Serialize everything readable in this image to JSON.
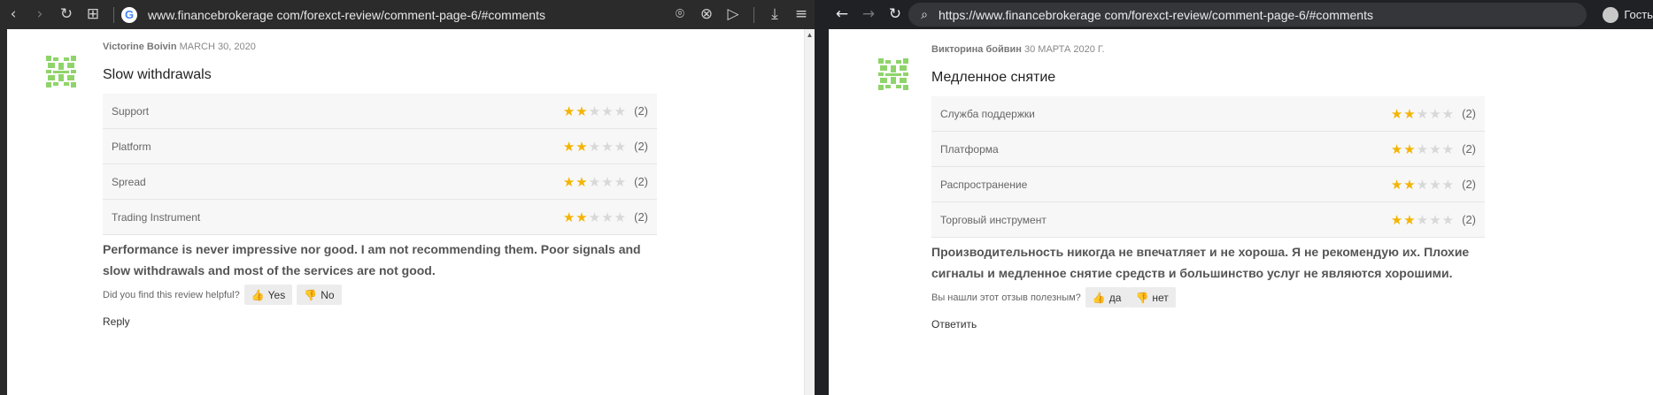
{
  "left": {
    "url": "www.financebrokerage com/forexct-review/comment-page-6/#comments",
    "google_glyph": "G",
    "review": {
      "author": "Victorine Boivin",
      "date": "MARCH 30, 2020",
      "title": "Slow withdrawals",
      "ratings": [
        {
          "label": "Support",
          "rating": 2,
          "count": "(2)"
        },
        {
          "label": "Platform",
          "rating": 2,
          "count": "(2)"
        },
        {
          "label": "Spread",
          "rating": 2,
          "count": "(2)"
        },
        {
          "label": "Trading Instrument",
          "rating": 2,
          "count": "(2)"
        }
      ],
      "text": "Performance is never impressive nor good. I am not recommending them. Poor signals and slow withdrawals and most of the services are not good.",
      "helpful_question": "Did you find this review helpful?",
      "yes_label": "Yes",
      "no_label": "No",
      "reply_label": "Reply"
    }
  },
  "right": {
    "url": "https://www.financebrokerage com/forexct-review/comment-page-6/#comments",
    "profile_label": "Гость",
    "review": {
      "author": "Викторина бойвин",
      "date": "30 МАРТА 2020 Г.",
      "title": "Медленное снятие",
      "ratings": [
        {
          "label": "Служба поддержки",
          "rating": 2,
          "count": "(2)"
        },
        {
          "label": "Платформа",
          "rating": 2,
          "count": "(2)"
        },
        {
          "label": "Распространение",
          "rating": 2,
          "count": "(2)"
        },
        {
          "label": "Торговый инструмент",
          "rating": 2,
          "count": "(2)"
        }
      ],
      "text": "Производительность никогда не впечатляет и не хороша. Я не рекомендую их. Плохие сигналы и медленное снятие средств и большинство услуг не являются хорошими.",
      "helpful_question": "Вы нашли этот отзыв полезным?",
      "yes_label": "да",
      "no_label": "нет",
      "reply_label": "Ответить"
    }
  },
  "colors": {
    "star_on": "#f4b400",
    "star_off": "#d8d8d8",
    "avatar_green": "#8fd46b"
  }
}
